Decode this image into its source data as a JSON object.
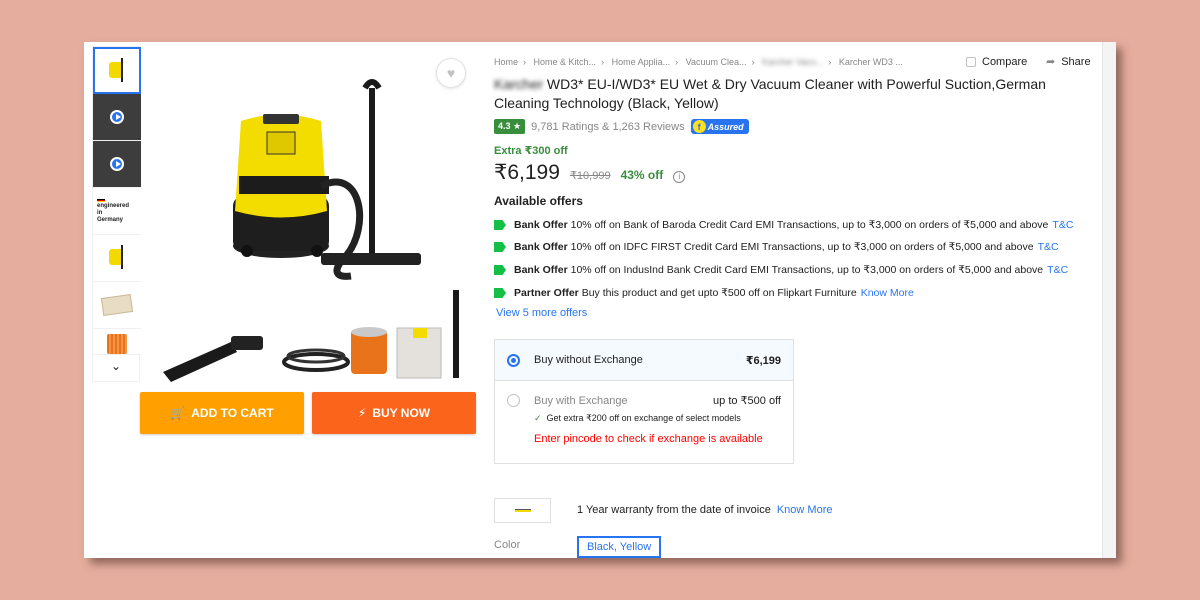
{
  "thumbnails": [
    {
      "kind": "product",
      "active": true
    },
    {
      "kind": "video"
    },
    {
      "kind": "video"
    },
    {
      "kind": "badge",
      "lines": [
        "engineered",
        "in",
        "Germany"
      ]
    },
    {
      "kind": "product"
    },
    {
      "kind": "cloth"
    },
    {
      "kind": "filter"
    }
  ],
  "breadcrumbs": [
    "Home",
    "Home & Kitch...",
    "Home Applia...",
    "Vacuum Clea...",
    "Karcher Vacu...",
    "Karcher WD3 ..."
  ],
  "compare_label": "Compare",
  "share_label": "Share",
  "product": {
    "brand": "Karcher",
    "title": "WD3* EU-I/WD3* EU Wet & Dry Vacuum Cleaner with Powerful Suction,German Cleaning Technology  (Black, Yellow)",
    "rating": "4.3",
    "ratings_reviews": "9,781 Ratings & 1,263 Reviews",
    "assured": "Assured",
    "extra_off": "Extra ₹300 off",
    "price": "₹6,199",
    "mrp": "₹10,999",
    "discount": "43% off"
  },
  "offers_heading": "Available offers",
  "offers": [
    {
      "type": "Bank Offer",
      "text": "10% off on Bank of Baroda Credit Card EMI Transactions, up to ₹3,000 on orders of ₹5,000 and above",
      "link": "T&C"
    },
    {
      "type": "Bank Offer",
      "text": "10% off on IDFC FIRST Credit Card EMI Transactions, up to ₹3,000 on orders of ₹5,000 and above",
      "link": "T&C"
    },
    {
      "type": "Bank Offer",
      "text": "10% off on IndusInd Bank Credit Card EMI Transactions, up to ₹3,000 on orders of ₹5,000 and above",
      "link": "T&C"
    },
    {
      "type": "Partner Offer",
      "text": "Buy this product and get upto ₹500 off on Flipkart Furniture",
      "link": "Know More"
    }
  ],
  "more_offers": "View 5 more offers",
  "exchange": {
    "without_label": "Buy without Exchange",
    "without_value": "₹6,199",
    "with_label": "Buy with Exchange",
    "with_value": "up to ₹500 off",
    "note": "Get extra ₹200 off on exchange of select models",
    "warning": "Enter pincode to check if exchange is available"
  },
  "warranty": {
    "text": "1 Year warranty from the date of invoice",
    "link": "Know More"
  },
  "color": {
    "label": "Color",
    "selected": "Black, Yellow"
  },
  "buttons": {
    "add_to_cart": "ADD TO CART",
    "buy_now": "BUY NOW"
  },
  "colors": {
    "accent": "#2874f0",
    "cart": "#ff9f00",
    "buy": "#fb641b",
    "green": "#388e3c",
    "background": "#e5ad9e"
  }
}
